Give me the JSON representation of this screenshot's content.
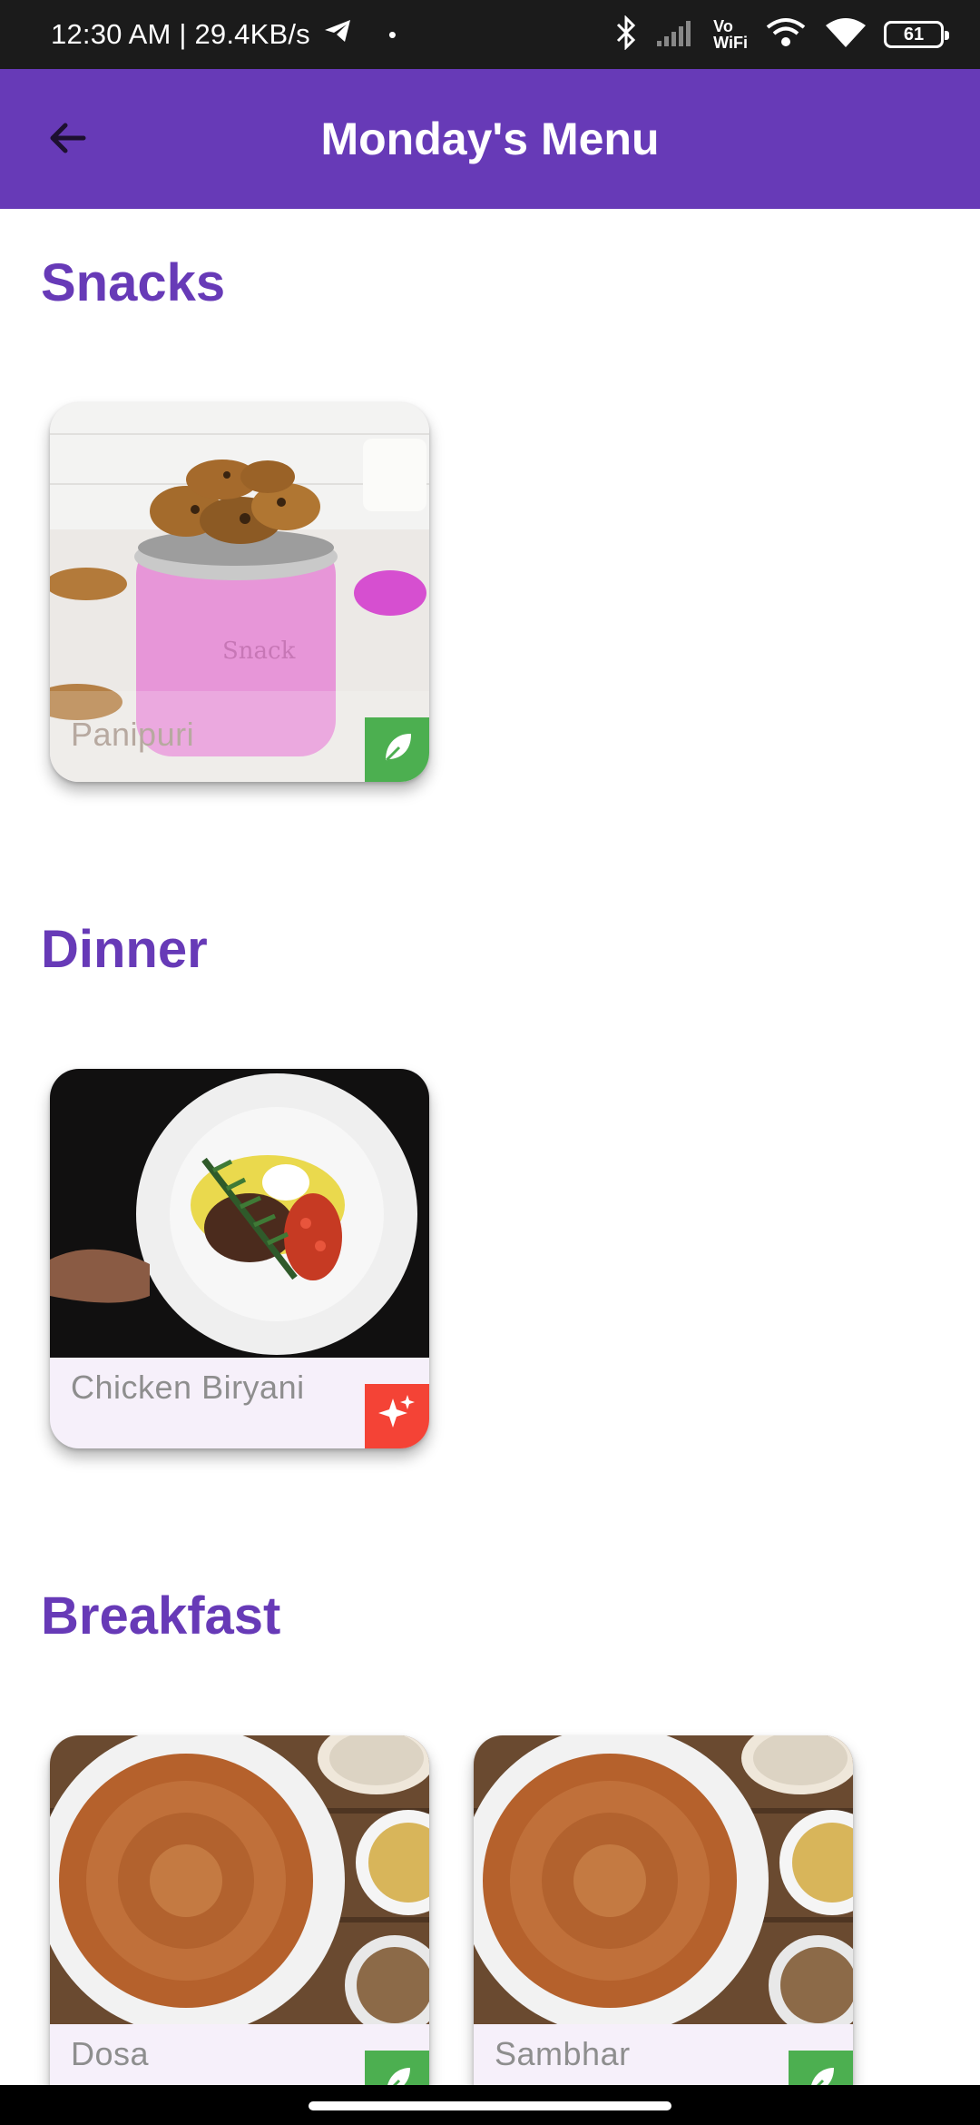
{
  "status_bar": {
    "time_speed": "12:30 AM | 29.4KB/s",
    "dot": "•",
    "vowifi_top": "Vo",
    "vowifi_bottom": "WiFi",
    "battery": "61"
  },
  "app_bar": {
    "title": "Monday's Menu",
    "back_icon": "arrow-back-icon"
  },
  "colors": {
    "primary": "#673ab7",
    "veg": "#4caf50",
    "nonveg": "#f44336"
  },
  "sections": [
    {
      "title": "Snacks",
      "items": [
        {
          "name": "Panipuri",
          "badge": "leaf-icon",
          "type": "veg"
        }
      ]
    },
    {
      "title": "Dinner",
      "items": [
        {
          "name": "Chicken Biryani",
          "badge": "sparkle-icon",
          "type": "nonveg"
        }
      ]
    },
    {
      "title": "Breakfast",
      "items": [
        {
          "name": "Dosa",
          "badge": "leaf-icon",
          "type": "veg"
        },
        {
          "name": "Sambhar",
          "badge": "leaf-icon",
          "type": "veg"
        }
      ]
    }
  ]
}
